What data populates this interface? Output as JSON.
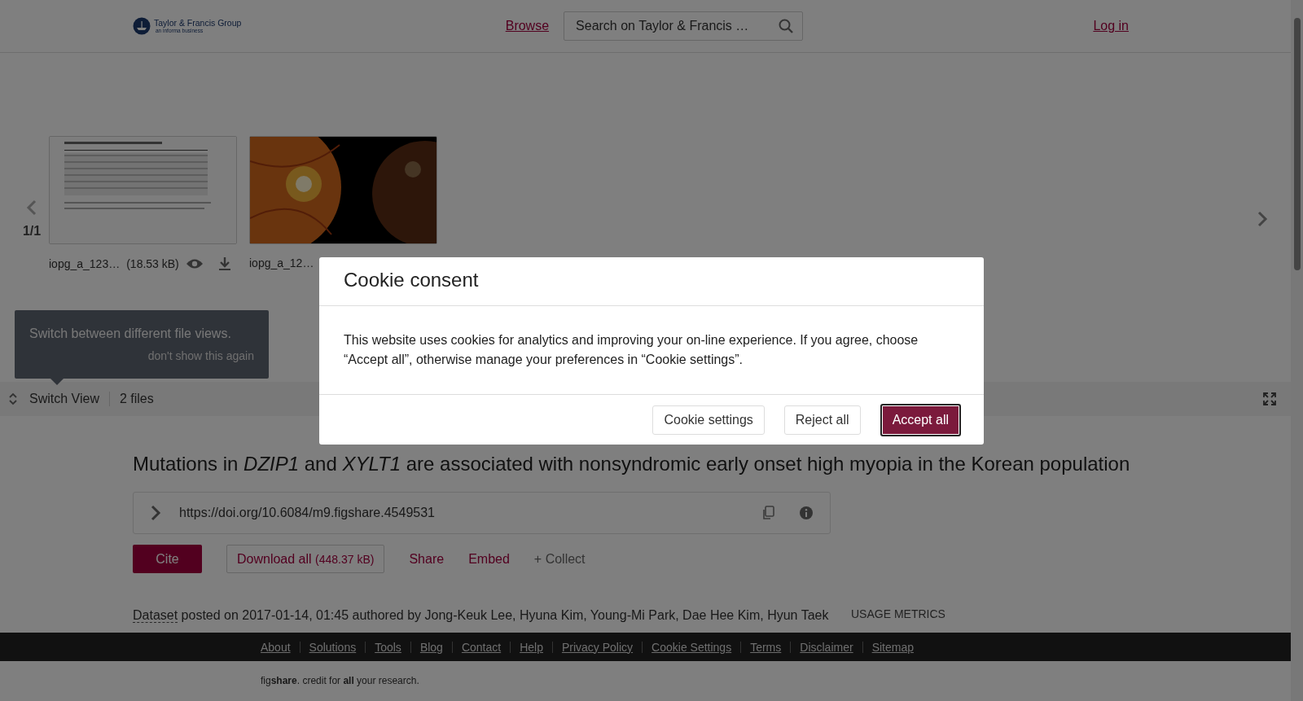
{
  "header": {
    "logo": {
      "name": "Taylor & Francis Group",
      "tagline": "an informa business"
    },
    "browse_link": "Browse",
    "search": {
      "placeholder": "Search on Taylor & Francis …"
    },
    "login_link": "Log in"
  },
  "viewer": {
    "pager": "1/1",
    "files": [
      {
        "name": "iopg_a_123…",
        "size": "(18.53 kB)",
        "kind": "document"
      },
      {
        "name": "iopg_a_12…"
      }
    ],
    "tooltip": {
      "text": "Switch between different file views.",
      "dismiss": "don't show this again"
    },
    "switch_view": "Switch View",
    "file_count": "2 files"
  },
  "article": {
    "title": "Mutations in *DZIP1* and *XYLT1* are associated with nonsyndromic early onset high myopia in the Korean population",
    "doi": "https://doi.org/10.6084/m9.figshare.4549531",
    "actions": [
      {
        "label": "Cite",
        "kind": "primary"
      },
      {
        "label": "Download all",
        "size": "(448.37 kB)",
        "kind": "outline"
      },
      {
        "label": "Share",
        "kind": "link"
      },
      {
        "label": "Embed",
        "kind": "link"
      },
      {
        "label": "+ Collect",
        "kind": "muted"
      }
    ],
    "type_link": "Dataset",
    "byline": " posted on 2017-01-14, 01:45 authored by Jong-Keuk Lee, Hyuna Kim, Young-Mi Park, Dae Hee Kim, Hyun Taek",
    "usage_heading": "USAGE METRICS"
  },
  "footer": {
    "links": [
      "About",
      "Solutions",
      "Tools",
      "Blog",
      "Contact",
      "Help",
      "Privacy Policy",
      "Cookie Settings",
      "Terms",
      "Disclaimer",
      "Sitemap"
    ],
    "credit": "fig**share**. credit for **all** your research."
  },
  "cookie_dialog": {
    "title": "Cookie consent",
    "body": "This website uses cookies for analytics and improving your on-line experience. If you agree, choose “Accept all”, otherwise manage your preferences in “Cookie settings”.",
    "buttons": [
      {
        "label": "Cookie settings",
        "kind": "secondary"
      },
      {
        "label": "Reject all",
        "kind": "secondary"
      },
      {
        "label": "Accept all",
        "kind": "primary"
      }
    ]
  }
}
